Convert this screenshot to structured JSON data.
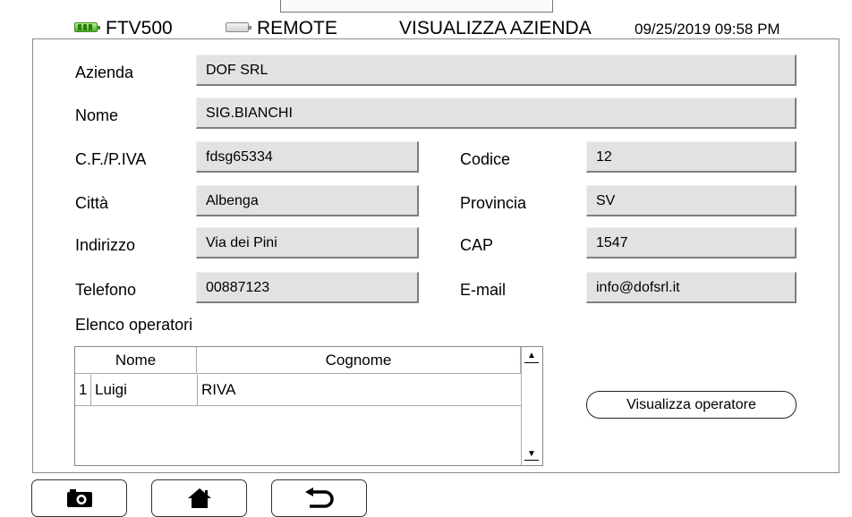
{
  "header": {
    "device_name": "FTV500",
    "mode": "REMOTE",
    "screen_title": "VISUALIZZA AZIENDA",
    "datetime": "09/25/2019 09:58 PM",
    "battery_device_icon": "battery-full-icon",
    "battery_remote_icon": "battery-empty-icon"
  },
  "form": {
    "azienda": {
      "label": "Azienda",
      "value": "DOF SRL"
    },
    "nome": {
      "label": "Nome",
      "value": "SIG.BIANCHI"
    },
    "cf_piva": {
      "label": "C.F./P.IVA",
      "value": "fdsg65334"
    },
    "codice": {
      "label": "Codice",
      "value": "12"
    },
    "citta": {
      "label": "Città",
      "value": "Albenga"
    },
    "provincia": {
      "label": "Provincia",
      "value": "SV"
    },
    "indirizzo": {
      "label": "Indirizzo",
      "value": "Via dei Pini"
    },
    "cap": {
      "label": "CAP",
      "value": "1547"
    },
    "telefono": {
      "label": "Telefono",
      "value": "00887123"
    },
    "email": {
      "label": "E-mail",
      "value": "info@dofsrl.it"
    }
  },
  "operators": {
    "title": "Elenco operatori",
    "columns": [
      "Nome",
      "Cognome"
    ],
    "rows": [
      {
        "index": "1",
        "nome": "Luigi",
        "cognome": "RIVA"
      }
    ],
    "scroll_up_icon": "arrow-up-icon",
    "scroll_down_icon": "arrow-down-icon"
  },
  "buttons": {
    "view_operator": "Visualizza operatore"
  },
  "toolbar": {
    "icons": [
      "camera-icon",
      "home-icon",
      "back-icon"
    ]
  }
}
